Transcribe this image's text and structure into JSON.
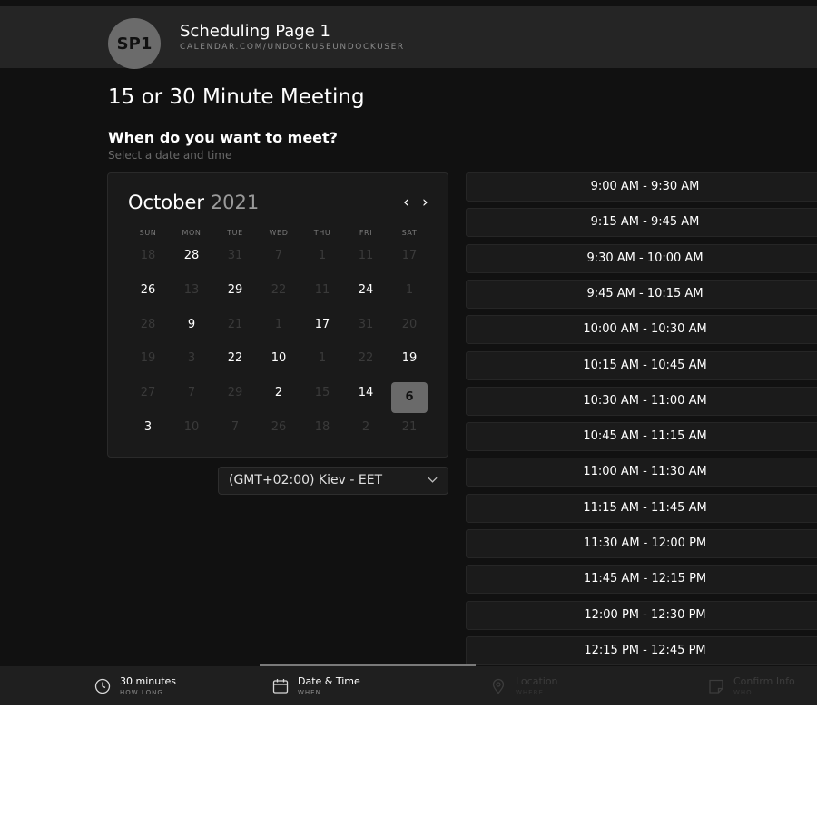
{
  "header": {
    "avatar_initials": "SP1",
    "page_name": "Scheduling Page 1",
    "page_url": "CALENDAR.COM/UNDOCKUSEUNDOCKUSER"
  },
  "event": {
    "title": "15 or 30 Minute Meeting",
    "question": "When do you want to meet?",
    "subtitle": "Select a date and time"
  },
  "calendar": {
    "month": "October",
    "year": "2021",
    "prev_icon": "chevron-left-icon",
    "next_icon": "chevron-right-icon",
    "weekdays": [
      "SUN",
      "MON",
      "TUE",
      "WED",
      "THU",
      "FRI",
      "SAT"
    ],
    "weeks": [
      [
        {
          "d": "18",
          "on": false
        },
        {
          "d": "28",
          "on": true
        },
        {
          "d": "31",
          "on": false
        },
        {
          "d": "7",
          "on": false
        },
        {
          "d": "1",
          "on": false
        },
        {
          "d": "11",
          "on": false
        },
        {
          "d": "17",
          "on": false
        }
      ],
      [
        {
          "d": "26",
          "on": true
        },
        {
          "d": "13",
          "on": false
        },
        {
          "d": "29",
          "on": true
        },
        {
          "d": "22",
          "on": false
        },
        {
          "d": "11",
          "on": false
        },
        {
          "d": "24",
          "on": true
        },
        {
          "d": "1",
          "on": false
        }
      ],
      [
        {
          "d": "28",
          "on": false
        },
        {
          "d": "9",
          "on": true
        },
        {
          "d": "21",
          "on": false
        },
        {
          "d": "1",
          "on": false
        },
        {
          "d": "17",
          "on": true
        },
        {
          "d": "31",
          "on": false
        },
        {
          "d": "20",
          "on": false
        }
      ],
      [
        {
          "d": "19",
          "on": false
        },
        {
          "d": "3",
          "on": false
        },
        {
          "d": "22",
          "on": true
        },
        {
          "d": "10",
          "on": true
        },
        {
          "d": "1",
          "on": false
        },
        {
          "d": "22",
          "on": false
        },
        {
          "d": "19",
          "on": true
        }
      ],
      [
        {
          "d": "27",
          "on": false
        },
        {
          "d": "7",
          "on": false
        },
        {
          "d": "29",
          "on": false
        },
        {
          "d": "2",
          "on": true
        },
        {
          "d": "15",
          "on": false
        },
        {
          "d": "14",
          "on": true
        },
        {
          "d": "6",
          "on": true,
          "selected": true
        }
      ],
      [
        {
          "d": "3",
          "on": true
        },
        {
          "d": "10",
          "on": false
        },
        {
          "d": "7",
          "on": false
        },
        {
          "d": "26",
          "on": false
        },
        {
          "d": "18",
          "on": false
        },
        {
          "d": "2",
          "on": false
        },
        {
          "d": "21",
          "on": false
        }
      ]
    ]
  },
  "timezone": {
    "label": "(GMT+02:00) Kiev - EET",
    "icon": "chevron-down-icon"
  },
  "time_slots": [
    "9:00 AM - 9:30 AM",
    "9:15 AM - 9:45 AM",
    "9:30 AM - 10:00 AM",
    "9:45 AM - 10:15 AM",
    "10:00 AM - 10:30 AM",
    "10:15 AM - 10:45 AM",
    "10:30 AM - 11:00 AM",
    "10:45 AM - 11:15 AM",
    "11:00 AM - 11:30 AM",
    "11:15 AM - 11:45 AM",
    "11:30 AM - 12:00 PM",
    "11:45 AM - 12:15 PM",
    "12:00 PM - 12:30 PM",
    "12:15 PM - 12:45 PM"
  ],
  "steps": [
    {
      "label": "30 minutes",
      "sub": "HOW LONG",
      "icon": "clock-icon",
      "state": "active"
    },
    {
      "label": "Date & Time",
      "sub": "WHEN",
      "icon": "calendar-icon",
      "state": "active",
      "current": true
    },
    {
      "label": "Location",
      "sub": "WHERE",
      "icon": "location-pin-icon",
      "state": "dim"
    },
    {
      "label": "Confirm Info",
      "sub": "WHO",
      "icon": "note-icon",
      "state": "dim"
    }
  ],
  "colors": {
    "background": "#111111",
    "header_bar": "#252525",
    "selected_day": "#6a6a6a",
    "muted_text": "#6a6a6a"
  }
}
